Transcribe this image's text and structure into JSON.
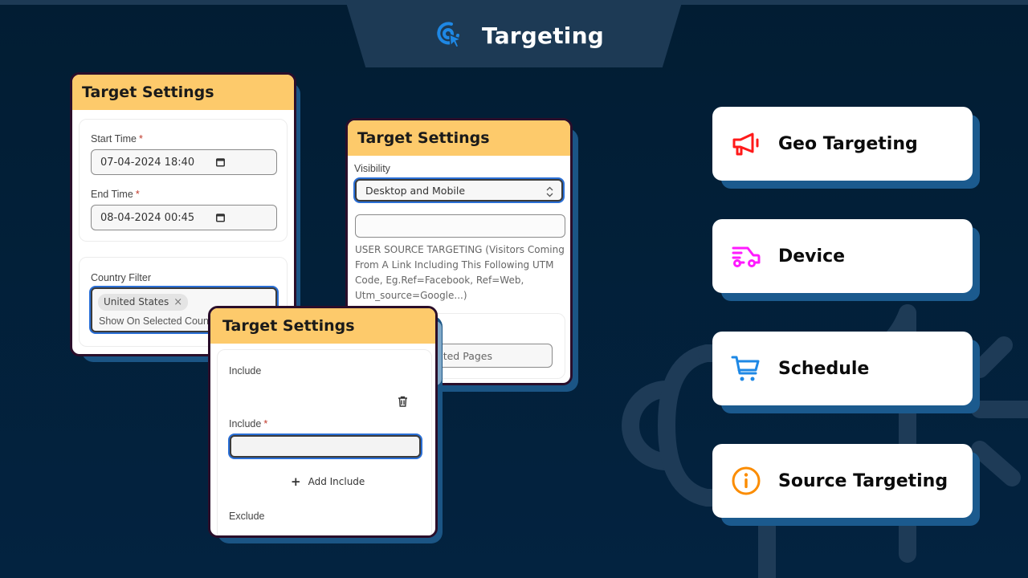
{
  "header": {
    "title": "Targeting",
    "icon": "target-click-icon"
  },
  "colors": {
    "background": "#03203a",
    "title_tab": "#1d3a55",
    "panel_header": "#fdca6b",
    "panel_border": "#2a0e2a",
    "shadow": "#1b5a8e",
    "focus": "#2a6fd6",
    "geo_icon": "#ff1a1a",
    "device_icon": "#ff1aff",
    "schedule_icon": "#1e88e5",
    "source_icon": "#fb8c00"
  },
  "panel_schedule": {
    "title": "Target Settings",
    "start_time_label": "Start Time",
    "start_time_value": "07-04-2024 18:40",
    "end_time_label": "End Time",
    "end_time_value": "08-04-2024 00:45",
    "required_mark": "*",
    "country_filter_label": "Country Filter",
    "country_chip": "United States",
    "chip_remove": "×",
    "country_mode_text": "Show On Selected Coun"
  },
  "panel_visibility": {
    "title": "Target Settings",
    "visibility_label": "Visibility",
    "visibility_value": "Desktop and Mobile",
    "utm_input_value": "",
    "utm_help": "USER SOURCE TARGETING (Visitors Coming From A Link Including This Following UTM Code, Eg.Ref=Facebook, Ref=Web, Utm_source=Google...)",
    "pages_select_value": "cted Pages"
  },
  "panel_include": {
    "title": "Target Settings",
    "include_section_label": "Include",
    "include_field_label": "Include",
    "required_mark": "*",
    "include_value": "",
    "add_include_label": "Add Include",
    "exclude_label": "Exclude"
  },
  "features": [
    {
      "label": "Geo Targeting",
      "icon": "megaphone-icon"
    },
    {
      "label": "Device",
      "icon": "delivery-truck-icon"
    },
    {
      "label": "Schedule",
      "icon": "shopping-cart-icon"
    },
    {
      "label": "Source Targeting",
      "icon": "info-circle-icon"
    }
  ]
}
